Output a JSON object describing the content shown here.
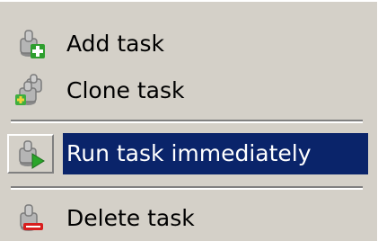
{
  "menu": {
    "items": [
      {
        "label": "Add task",
        "icon": "add-task-icon"
      },
      {
        "label": "Clone task",
        "icon": "clone-task-icon"
      },
      {
        "label": "Run task immediately",
        "icon": "run-task-icon",
        "highlighted": true
      },
      {
        "label": "Delete task",
        "icon": "delete-task-icon"
      }
    ]
  },
  "colors": {
    "menu_background": "#d4d0c8",
    "highlight": "#0a246a",
    "highlight_text": "#ffffff",
    "add_badge": "#2e9e2e",
    "run_badge": "#2aa52a",
    "delete_badge": "#d81e1e"
  }
}
